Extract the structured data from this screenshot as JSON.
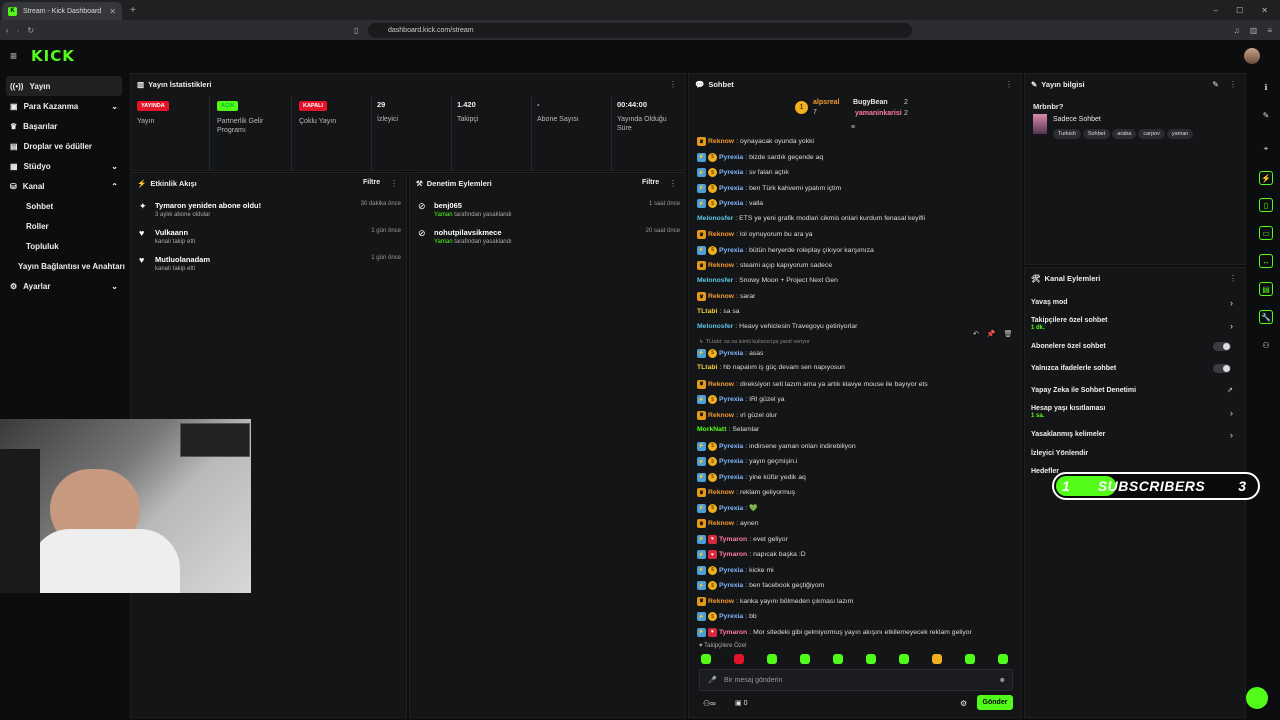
{
  "browser": {
    "tab_title": "Stream - Kick Dashboard",
    "url": "dashboard.kick.com/stream"
  },
  "header": {
    "logo": "KICK"
  },
  "sidebar": {
    "items": [
      {
        "label": "Yayın",
        "icon": "broadcast-icon"
      },
      {
        "label": "Para Kazanma",
        "icon": "money-icon"
      },
      {
        "label": "Başarılar",
        "icon": "trophy-icon"
      },
      {
        "label": "Droplar ve ödüller",
        "icon": "gift-icon"
      },
      {
        "label": "Stüdyo",
        "icon": "studio-icon"
      },
      {
        "label": "Kanal",
        "icon": "channel-icon"
      },
      {
        "label": "Sohbet"
      },
      {
        "label": "Roller"
      },
      {
        "label": "Topluluk"
      },
      {
        "label": "Yayın Bağlantısı ve Anahtarı"
      },
      {
        "label": "Ayarlar",
        "icon": "gear-icon"
      }
    ]
  },
  "stats": {
    "title": "Yayın İstatistikleri",
    "items": [
      {
        "badge": "YAYINDA",
        "label": "Yayın"
      },
      {
        "badge": "AÇIK",
        "label": "Partnerlik Gelir Programı"
      },
      {
        "badge": "KAPALI",
        "label": "Çoklu Yayın"
      },
      {
        "value": "29",
        "label": "İzleyici"
      },
      {
        "value": "1.420",
        "label": "Takipçi"
      },
      {
        "value": "-",
        "label": "Abone Sayısı"
      },
      {
        "value": "00:44:00",
        "label": "Yayında Olduğu Süre"
      }
    ]
  },
  "activity": {
    "title": "Etkinlik Akışı",
    "filter": "Filtre",
    "items": [
      {
        "t1": "Tymaron yeniden abone oldu!",
        "t2": "3 aylık abone oldular",
        "time": "30 dakika önce"
      },
      {
        "t1": "Vulkaann",
        "t2": "kanalı takip etti",
        "time": "1 gün önce"
      },
      {
        "t1": "Mutluolanadam",
        "t2": "kanalı takip etti",
        "time": "1 gün önce"
      }
    ]
  },
  "moderation": {
    "title": "Denetim Eylemleri",
    "filter": "Filtre",
    "items": [
      {
        "t1": "benj065",
        "by": "Yaman",
        "t2": " tarafından yasaklandı",
        "time": "1 saat önce"
      },
      {
        "t1": "nohutpilavsikmece",
        "by": "Yaman",
        "t2": " tarafından yasaklandı",
        "time": "20 saat önce"
      }
    ]
  },
  "chat": {
    "title": "Sohbet",
    "top": [
      {
        "name": "alpsreal",
        "count": "7"
      },
      {
        "name": "BugyBean",
        "count": "2"
      },
      {
        "name": "yamaninkarisi",
        "count": "2"
      }
    ],
    "messages": [
      {
        "b": [
          "crown"
        ],
        "u": "Reknow",
        "c": "c-or",
        "m": "oynayacak oyunda yokki"
      },
      {
        "b": [
          "blue",
          "coin"
        ],
        "u": "Pyrexia",
        "c": "c-bl",
        "m": "bizde sardık geçende aq"
      },
      {
        "b": [
          "blue",
          "coin"
        ],
        "u": "Pyrexia",
        "c": "c-bl",
        "m": "sv falan açtık"
      },
      {
        "b": [
          "blue",
          "coin"
        ],
        "u": "Pyrexia",
        "c": "c-bl",
        "m": "ben Türk kahvemi ypatım içtim"
      },
      {
        "b": [
          "blue",
          "coin"
        ],
        "u": "Pyrexia",
        "c": "c-bl",
        "m": "valla"
      },
      {
        "b": [],
        "u": "Melonosfer",
        "c": "c-cy",
        "m": "ETS ye yeni grafik modlari cikmis onlari kurdum fenasal keyifli"
      },
      {
        "b": [
          "crown"
        ],
        "u": "Reknow",
        "c": "c-or",
        "m": "lol oynuyorum bu ara ya"
      },
      {
        "b": [
          "blue",
          "coin"
        ],
        "u": "Pyrexia",
        "c": "c-bl",
        "m": "bütün heryerde roleplay çıkıyor karşımıza"
      },
      {
        "b": [
          "crown"
        ],
        "u": "Reknow",
        "c": "c-or",
        "m": "steami açıp kapıyorum sadece"
      },
      {
        "b": [],
        "u": "Melonosfer",
        "c": "c-cy",
        "m": "Snowy Moon + Project Next Gen"
      },
      {
        "b": [
          "crown"
        ],
        "u": "Reknow",
        "c": "c-or",
        "m": "sarar"
      },
      {
        "b": [],
        "u": "TLtabi",
        "c": "c-yl",
        "m": "sa sa"
      },
      {
        "b": [],
        "u": "Melonosfer",
        "c": "c-cy",
        "m": "Heavy vehiclesin Travegoyu getiriyorlar"
      },
      {
        "reply": "TLtabi: sa sa isimli kullanıcıya yanıt veriyor"
      },
      {
        "b": [
          "blue",
          "coin"
        ],
        "u": "Pyrexia",
        "c": "c-bl",
        "m": "asas"
      },
      {
        "b": [],
        "u": "TLtabi",
        "c": "c-yl",
        "m": "hb napalım iş güç devam sen napıyosun"
      },
      {
        "b": [
          "crown"
        ],
        "u": "Reknow",
        "c": "c-or",
        "m": "direksiyon seti lazım ama ya artık klavye mouse ile bayıyor ets"
      },
      {
        "b": [
          "blue",
          "coin"
        ],
        "u": "Pyrexia",
        "c": "c-bl",
        "m": "IRl güzel ya"
      },
      {
        "b": [
          "crown"
        ],
        "u": "Reknow",
        "c": "c-or",
        "m": "ırl güzel olur"
      },
      {
        "b": [],
        "u": "MorkNatt",
        "c": "c-gr",
        "m": "Selamlar"
      },
      {
        "b": [
          "blue",
          "coin"
        ],
        "u": "Pyrexia",
        "c": "c-bl",
        "m": "indirsene yaman onları indirebiliyon"
      },
      {
        "b": [
          "blue",
          "coin"
        ],
        "u": "Pyrexia",
        "c": "c-bl",
        "m": "yayın geçmişin.i"
      },
      {
        "b": [
          "blue",
          "coin"
        ],
        "u": "Pyrexia",
        "c": "c-bl",
        "m": "yine küfür yedik aq"
      },
      {
        "b": [
          "crown"
        ],
        "u": "Reknow",
        "c": "c-or",
        "m": "reklam geliyormuş"
      },
      {
        "b": [
          "blue",
          "coin"
        ],
        "u": "Pyrexia",
        "c": "c-bl",
        "m": "💚"
      },
      {
        "b": [
          "crown"
        ],
        "u": "Reknow",
        "c": "c-or",
        "m": "aynen"
      },
      {
        "b": [
          "blue",
          "red"
        ],
        "u": "Tymaron",
        "c": "c-pk",
        "m": "evet geliyor"
      },
      {
        "b": [
          "blue",
          "red"
        ],
        "u": "Tymaron",
        "c": "c-pk",
        "m": "napıcak başka :D"
      },
      {
        "b": [
          "blue",
          "coin"
        ],
        "u": "Pyrexia",
        "c": "c-bl",
        "m": "kicke mi"
      },
      {
        "b": [
          "blue",
          "coin"
        ],
        "u": "Pyrexia",
        "c": "c-bl",
        "m": "ben facebook geçtiğiyom"
      },
      {
        "b": [
          "crown"
        ],
        "u": "Reknow",
        "c": "c-or",
        "m": "kanka yayını bölmeden çıkması lazım"
      },
      {
        "b": [
          "blue",
          "coin"
        ],
        "u": "Pyrexia",
        "c": "c-bl",
        "m": "bb"
      },
      {
        "b": [
          "blue",
          "red"
        ],
        "u": "Tymaron",
        "c": "c-pk",
        "m": "Mor sitedeki gibi gelmiyormuş yayın akışını etkilemeyecek reklam geliyor"
      }
    ],
    "followers_only": "Takipçilere Özel",
    "input_placeholder": "Bir mesaj gönderin",
    "count": "0",
    "send": "Gönder"
  },
  "info": {
    "title": "Yayın bilgisi",
    "stream_title": "Mrbnbr?",
    "category": "Sadece Sohbet",
    "tags": [
      "Turkish",
      "Sohbet",
      "araba",
      "carpov",
      "yaman"
    ]
  },
  "channel_actions": {
    "title": "Kanal Eylemleri",
    "items": [
      {
        "label": "Yavaş mod",
        "type": "arrow"
      },
      {
        "label": "Takipçilere özel sohbet",
        "sub": "1 dk.",
        "type": "arrow"
      },
      {
        "label": "Abonelere özel sohbet",
        "type": "toggle"
      },
      {
        "label": "Yalnızca ifadelerle sohbet",
        "type": "toggle"
      },
      {
        "label": "Yapay Zeka ile Sohbet Denetimi",
        "type": "ext"
      },
      {
        "label": "Hesap yaşı kısıtlaması",
        "sub": "1 sa.",
        "type": "arrow"
      },
      {
        "label": "Yasaklanmış kelimeler",
        "type": "arrow"
      },
      {
        "label": "İzleyici Yönlendir",
        "type": "none"
      },
      {
        "label": "Hedefler",
        "type": "none"
      }
    ]
  },
  "overlay": {
    "left": "1",
    "label": "SUBSCRIBERS",
    "right": "3"
  }
}
